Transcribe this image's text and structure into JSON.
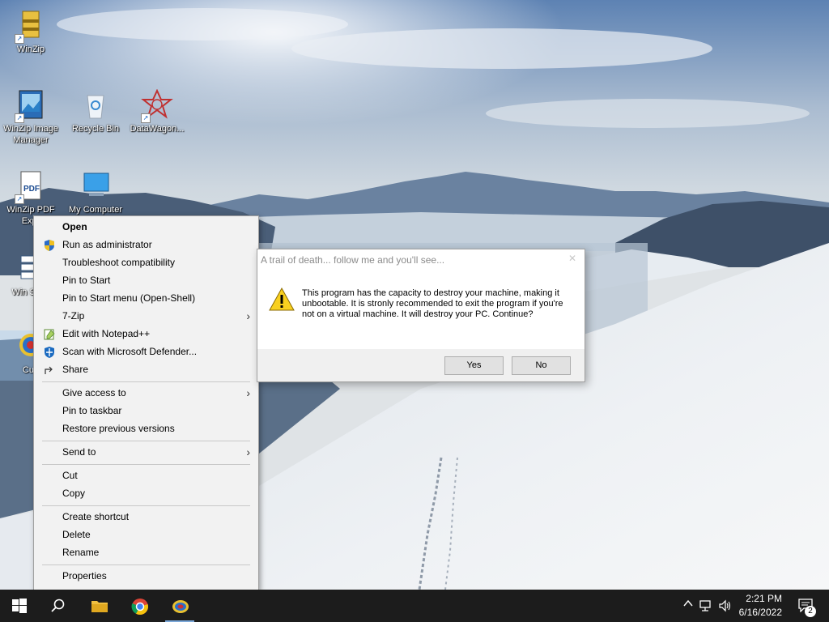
{
  "desktop": {
    "icons": [
      {
        "label": "WinZip"
      },
      {
        "label": "WinZip Image Manager"
      },
      {
        "label": "Recycle Bin"
      },
      {
        "label": "DataWagon..."
      },
      {
        "label": "WinZip PDF Expr"
      },
      {
        "label": "My Computer"
      },
      {
        "label": "Win Secu"
      },
      {
        "label": "Cub"
      }
    ]
  },
  "context_menu": {
    "items": [
      {
        "label": "Open"
      },
      {
        "label": "Run as administrator"
      },
      {
        "label": "Troubleshoot compatibility"
      },
      {
        "label": "Pin to Start"
      },
      {
        "label": "Pin to Start menu (Open-Shell)"
      },
      {
        "label": "7-Zip"
      },
      {
        "label": "Edit with Notepad++"
      },
      {
        "label": "Scan with Microsoft Defender..."
      },
      {
        "label": "Share"
      },
      {
        "label": "Give access to"
      },
      {
        "label": "Pin to taskbar"
      },
      {
        "label": "Restore previous versions"
      },
      {
        "label": "Send to"
      },
      {
        "label": "Cut"
      },
      {
        "label": "Copy"
      },
      {
        "label": "Create shortcut"
      },
      {
        "label": "Delete"
      },
      {
        "label": "Rename"
      },
      {
        "label": "Properties"
      }
    ]
  },
  "dialog": {
    "title": "A trail of death... follow me and you'll see...",
    "close": "✕",
    "message": "This program has the capacity to destroy your machine, making it unbootable. It is stronly recommended to exit the program if you're not on a virtual machine. It will destroy your PC. Continue?",
    "yes_label": "Yes",
    "no_label": "No"
  },
  "taskbar": {
    "time": "2:21 PM",
    "date": "6/16/2022",
    "notification_count": "2",
    "colors": {
      "background": "#1c1c1c",
      "accent": "#7aa7d8"
    }
  }
}
